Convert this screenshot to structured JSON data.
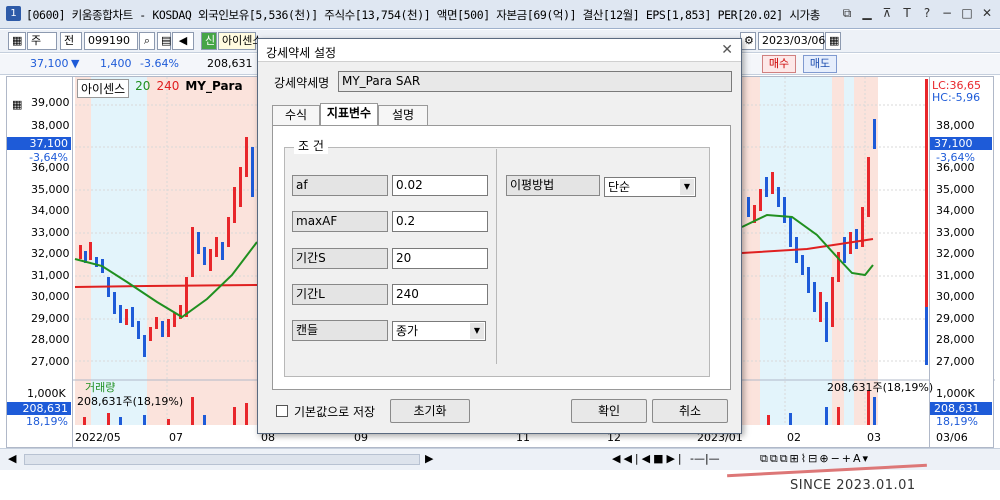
{
  "window": {
    "icon_label": "1",
    "title": "[0600] 키움종합차트 - KOSDAQ 외국인보유[5,536(천)] 주식수[13,754(천)] 액면[500] 자본금[69(억)] 결산[12월] EPS[1,853] PER[20.02] 시가총"
  },
  "toolbar": {
    "mode": "주",
    "period": "전",
    "code": "099190",
    "credit_badge": "신",
    "stock_name": "아이센스",
    "date": "2023/03/06"
  },
  "quote": {
    "price": "37,100",
    "change": "1,400",
    "change_pct": "-3.64%",
    "volume": "208,631",
    "buy_label": "매수",
    "sell_label": "매도"
  },
  "chart": {
    "legend_name": "아이센스",
    "ma1": "20",
    "ma2": "240",
    "indicator": "MY_Para",
    "lc": "LC:36,65",
    "hc": "HC:-5,96",
    "price_ticks": [
      "39,000",
      "38,000",
      "37,000",
      "36,000",
      "35,000",
      "34,000",
      "33,000",
      "32,000",
      "31,000",
      "30,000",
      "29,000",
      "28,000",
      "27,000"
    ],
    "current_price_tag": "37,100",
    "current_pct_tag": "-3,64%",
    "volume_title": "거래량",
    "volume_value": "208,631주(18,19%)",
    "volume_tick": "1,000K",
    "volume_tag": "208,631",
    "volume_pct_tag": "18,19%",
    "x_labels": [
      "2022/05",
      "07",
      "08",
      "09",
      "11",
      "12",
      "2023/01",
      "02",
      "03",
      "03/06"
    ]
  },
  "dialog": {
    "title": "강세약세 설정",
    "name_label": "강세약세명",
    "name_value": "MY_Para SAR",
    "tabs": [
      "수식",
      "지표변수",
      "설명"
    ],
    "group_title": "조 건",
    "params": [
      {
        "label": "af",
        "value": "0.02"
      },
      {
        "label": "maxAF",
        "value": "0.2"
      },
      {
        "label": "기간S",
        "value": "20"
      },
      {
        "label": "기간L",
        "value": "240"
      }
    ],
    "candle_label": "캔들",
    "candle_value": "종가",
    "ma_method_label": "이평방법",
    "ma_method_value": "단순",
    "default_save_label": "기본값으로 저장",
    "reset_label": "초기화",
    "ok_label": "확인",
    "cancel_label": "취소"
  },
  "footer_text": "SINCE 2023.01.01",
  "colors": {
    "up": "#e8262b",
    "down": "#1e5bd8",
    "ma_green": "#209020",
    "ma_red": "#e02020"
  }
}
